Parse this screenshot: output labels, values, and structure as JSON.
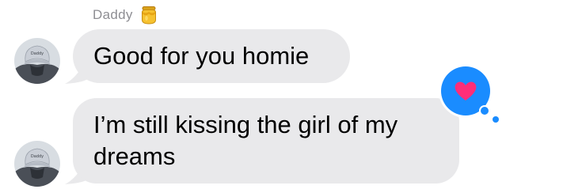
{
  "conversation": {
    "sender_name": "Daddy",
    "sender_emoji_icon": "honey-pot-icon",
    "avatar_cap_text": "Daddy",
    "messages": [
      {
        "text": "Good for you homie"
      },
      {
        "text": "I’m still kissing the girl of my dreams"
      }
    ],
    "tapback": {
      "icon": "heart-icon",
      "color": "#1a8cff",
      "heart_color": "#ff2d78"
    }
  },
  "colors": {
    "bubble_received": "#e9e9eb",
    "sender_label": "#8e8e93"
  }
}
